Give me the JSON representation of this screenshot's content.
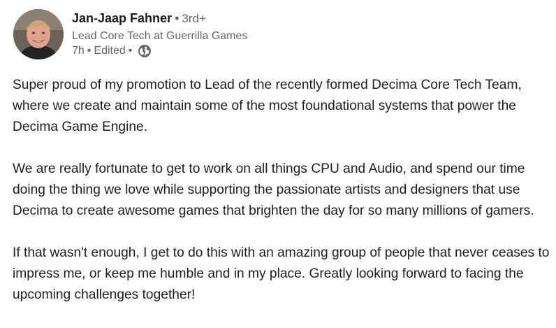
{
  "author": {
    "name": "Jan-Jaap Fahner",
    "separator": "•",
    "degree": "3rd+",
    "headline": "Lead Core Tech at Guerrilla Games",
    "time": "7h",
    "edited": "Edited",
    "visibility_icon": "globe-icon"
  },
  "post": {
    "paragraphs": [
      "Super proud of my promotion to Lead of the recently formed Decima Core Tech Team, where we create and maintain some of the most foundational systems that power the Decima Game Engine.",
      "We are really fortunate to get to work on all things CPU and Audio, and spend our time doing the thing we love while supporting the passionate artists and designers that use Decima to create awesome games that brighten the day for so many millions of gamers.",
      "If that wasn't enough, I get to do this with an amazing group of people that never ceases to impress me, or keep me humble and in my place. Greatly looking forward to facing the upcoming challenges together!"
    ]
  }
}
